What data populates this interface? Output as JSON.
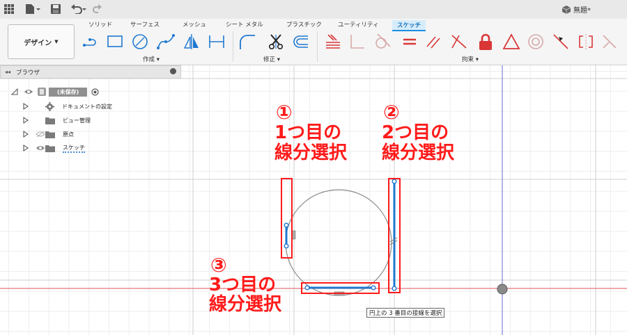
{
  "titlebar": {
    "document_title": "無題*"
  },
  "ribbon": {
    "design_button": "デザイン",
    "tabs": [
      {
        "label": "ソリッド",
        "active": false
      },
      {
        "label": "サーフェス",
        "active": false
      },
      {
        "label": "メッシュ",
        "active": false
      },
      {
        "label": "シート メタル",
        "active": false
      },
      {
        "label": "プラスチック",
        "active": false
      },
      {
        "label": "ユーティリティ",
        "active": false
      },
      {
        "label": "スケッチ",
        "active": true
      }
    ],
    "groups": {
      "create": "作成",
      "modify": "修正",
      "constraints": "拘束"
    }
  },
  "browser": {
    "title": "ブラウザ",
    "root_label": "(未保存)",
    "items": [
      {
        "label": "ドキュメントの設定",
        "icon": "gear-icon"
      },
      {
        "label": "ビュー管理",
        "icon": "folder-icon"
      },
      {
        "label": "原点",
        "icon": "folder-icon"
      },
      {
        "label": "スケッチ",
        "icon": "folder-icon"
      }
    ]
  },
  "annotations": {
    "one": {
      "num": "①",
      "line1": "1つ目の",
      "line2": "線分選択"
    },
    "two": {
      "num": "②",
      "line1": "2つ目の",
      "line2": "線分選択"
    },
    "three": {
      "num": "③",
      "line1": "3つ目の",
      "line2": "線分選択"
    }
  },
  "status_tip": "円上の 3 番目の接線を選択",
  "colors": {
    "annotation_red": "#ff1a1a",
    "sketch_blue": "#1f78d1",
    "active_tab": "#1a8fe3",
    "constraint_red": "#d93636"
  }
}
